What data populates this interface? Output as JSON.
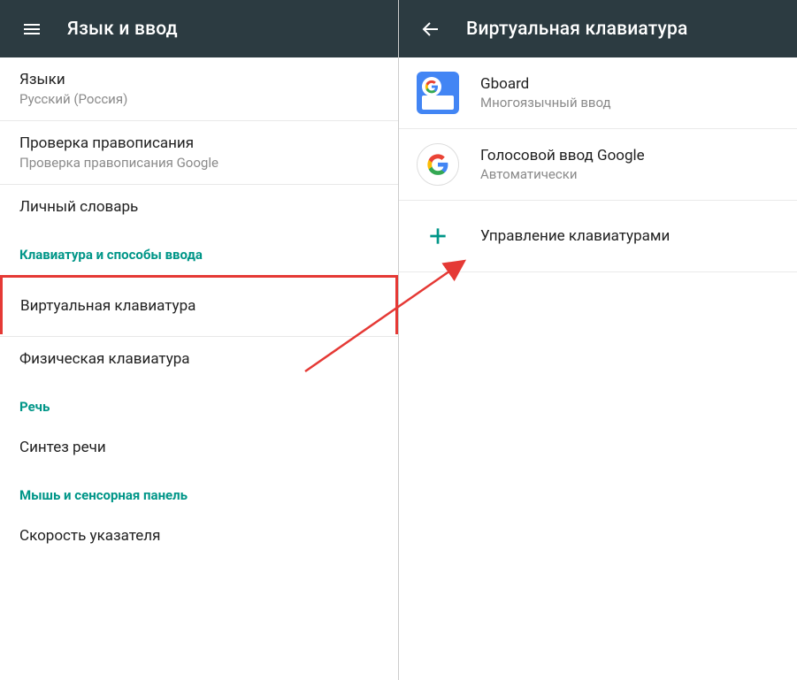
{
  "left": {
    "title": "Язык и ввод",
    "rows": {
      "languages": {
        "title": "Языки",
        "subtitle": "Русский (Россия)"
      },
      "spellcheck": {
        "title": "Проверка правописания",
        "subtitle": "Проверка правописания Google"
      },
      "dictionary": {
        "title": "Личный словарь"
      }
    },
    "sections": {
      "keyboard": "Клавиатура и способы ввода",
      "speech": "Речь",
      "mouse": "Мышь и сенсорная панель"
    },
    "items": {
      "virtual_keyboard": "Виртуальная клавиатура",
      "physical_keyboard": "Физическая клавиатура",
      "tts": "Синтез речи",
      "pointer_speed": "Скорость указателя"
    }
  },
  "right": {
    "title": "Виртуальная клавиатура",
    "gboard": {
      "title": "Gboard",
      "subtitle": "Многоязычный ввод"
    },
    "gvoice": {
      "title": "Голосовой ввод Google",
      "subtitle": "Автоматически"
    },
    "manage": {
      "title": "Управление клавиатурами"
    }
  }
}
